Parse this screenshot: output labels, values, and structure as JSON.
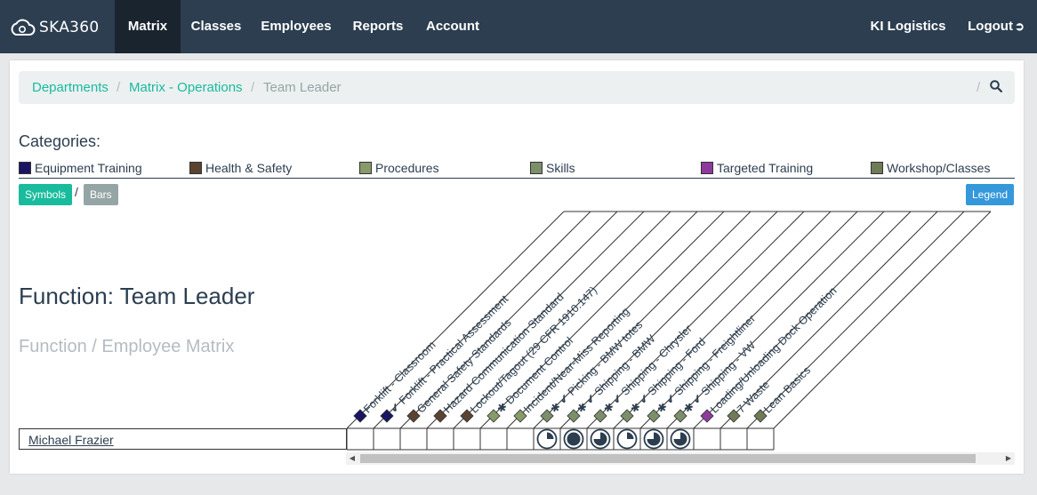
{
  "navbar": {
    "brand": "SKA360",
    "items": [
      {
        "label": "Matrix",
        "active": true
      },
      {
        "label": "Classes",
        "active": false
      },
      {
        "label": "Employees",
        "active": false
      },
      {
        "label": "Reports",
        "active": false
      },
      {
        "label": "Account",
        "active": false
      }
    ],
    "company": "KI Logistics",
    "logout": "Logout"
  },
  "breadcrumb": {
    "items": [
      "Departments",
      "Matrix - Operations",
      "Team Leader"
    ],
    "separator": "/"
  },
  "categories": {
    "title": "Categories:",
    "items": [
      {
        "label": "Equipment Training",
        "color": "#1b1464"
      },
      {
        "label": "Health & Safety",
        "color": "#5b4332"
      },
      {
        "label": "Procedures",
        "color": "#879a6a"
      },
      {
        "label": "Skills",
        "color": "#7c8f6b"
      },
      {
        "label": "Targeted Training",
        "color": "#8e3a9d"
      },
      {
        "label": "Workshop/Classes",
        "color": "#6f7a58"
      }
    ]
  },
  "view_toggle": {
    "symbols": "Symbols",
    "separator": "/",
    "bars": "Bars"
  },
  "legend_button": "Legend",
  "function_title": "Function: Team Leader",
  "matrix_subtitle": "Function / Employee Matrix",
  "columns": [
    {
      "label": "Forklift - Classroom",
      "color": "#1b1464",
      "marks": ""
    },
    {
      "label": "Forklift - Practical Assessment",
      "color": "#1b1464",
      "marks": "check"
    },
    {
      "label": "General Safety Standards",
      "color": "#5b4332",
      "marks": ""
    },
    {
      "label": "Hazard Communication Standard",
      "color": "#5b4332",
      "marks": ""
    },
    {
      "label": "Lockout/Tagout (29 CFR 1910.147)",
      "color": "#5b4332",
      "marks": ""
    },
    {
      "label": "Document Control",
      "color": "#879a6a",
      "marks": "star"
    },
    {
      "label": "Incident/Near-Miss Reporting",
      "color": "#879a6a",
      "marks": ""
    },
    {
      "label": "Picking - BMW totes",
      "color": "#7c8f6b",
      "marks": "star-check"
    },
    {
      "label": "Shipping - BMW",
      "color": "#7c8f6b",
      "marks": "star-check"
    },
    {
      "label": "Shipping - Chrysler",
      "color": "#7c8f6b",
      "marks": "star-check"
    },
    {
      "label": "Shipping - Ford",
      "color": "#7c8f6b",
      "marks": "star-check"
    },
    {
      "label": "Shipping - Freightliner",
      "color": "#7c8f6b",
      "marks": "star-check"
    },
    {
      "label": "Shipping - VW",
      "color": "#7c8f6b",
      "marks": "star-check"
    },
    {
      "label": "Loading/Unloading Dock Operation",
      "color": "#8e3a9d",
      "marks": ""
    },
    {
      "label": "7 Waste",
      "color": "#6f7a58",
      "marks": ""
    },
    {
      "label": "Lean Basics",
      "color": "#6f7a58",
      "marks": ""
    }
  ],
  "employees": [
    {
      "name": "Michael Frazier",
      "progress": [
        null,
        null,
        null,
        null,
        null,
        null,
        null,
        0.25,
        1.0,
        0.75,
        0.25,
        0.75,
        0.75,
        null,
        null,
        null
      ]
    }
  ]
}
